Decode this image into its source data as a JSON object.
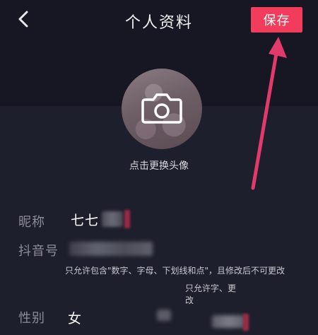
{
  "header": {
    "title": "个人资料",
    "save_label": "保存"
  },
  "avatar": {
    "change_hint": "点击更换头像"
  },
  "fields": {
    "nickname_label": "昵称",
    "nickname_value": "七七",
    "douyin_id_label": "抖音号",
    "douyin_rule": "只允许包含\"数字、字母、下划线和点\"，且修改后不可更改",
    "douyin_tooltip": "只允许字、更改",
    "gender_label": "性别",
    "gender_value": "女"
  },
  "colors": {
    "accent": "#f23c5c",
    "background": "#14151f",
    "panel": "#1d1f2c",
    "label_gray": "#8c8d99",
    "annotation_arrow": "#e23a6a"
  },
  "icons": {
    "back": "chevron-left-icon",
    "camera": "camera-icon",
    "annotation": "arrow-annotation"
  }
}
